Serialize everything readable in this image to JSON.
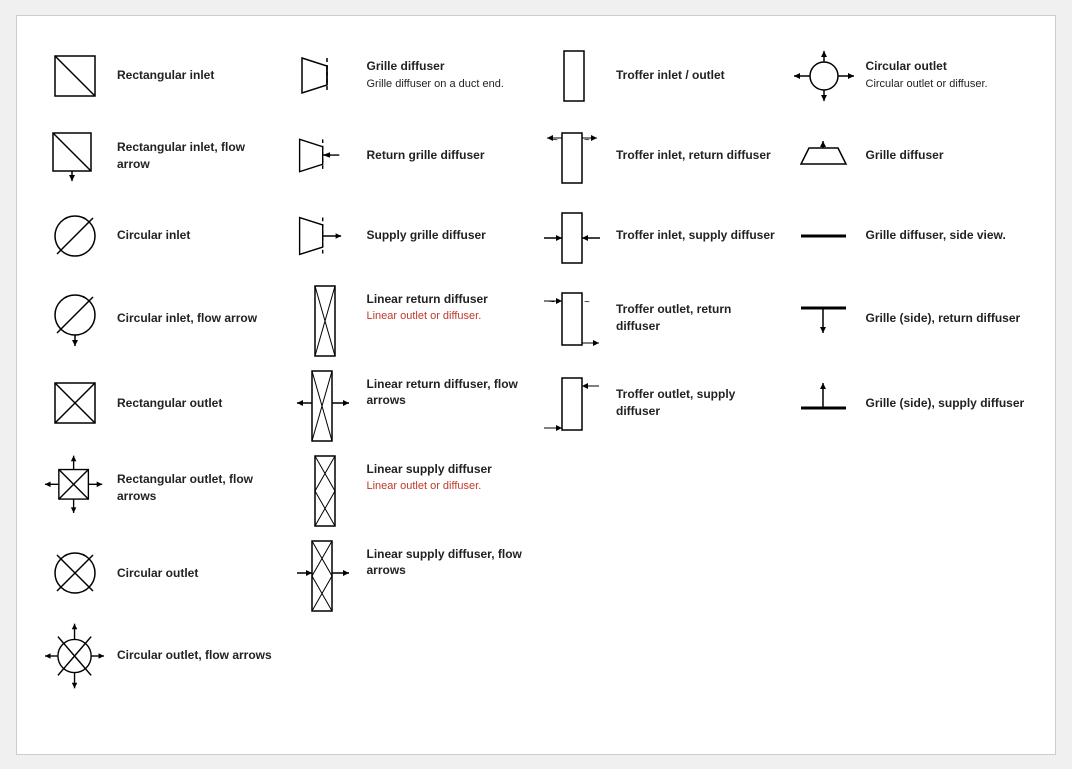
{
  "items": [
    {
      "id": "rectangular-inlet",
      "label": "Rectangular inlet",
      "sub": null,
      "sub_color": null,
      "col": 0,
      "row": 0
    },
    {
      "id": "grille-diffuser",
      "label": "Grille diffuser",
      "sub": "Grille diffuser on a duct end.",
      "sub_color": "black",
      "col": 1,
      "row": 0
    },
    {
      "id": "troffer-inlet-outlet",
      "label": "Troffer inlet / outlet",
      "sub": null,
      "sub_color": null,
      "col": 2,
      "row": 0
    },
    {
      "id": "circular-outlet-diffuser",
      "label": "Circular outlet",
      "sub": "Circular outlet or diffuser.",
      "sub_color": "black",
      "col": 3,
      "row": 0
    },
    {
      "id": "rectangular-inlet-flow",
      "label": "Rectangular inlet, flow arrow",
      "sub": null,
      "sub_color": null,
      "col": 0,
      "row": 1
    },
    {
      "id": "return-grille-diffuser",
      "label": "Return grille diffuser",
      "sub": null,
      "sub_color": null,
      "col": 1,
      "row": 1
    },
    {
      "id": "troffer-inlet-return",
      "label": "Troffer inlet, return diffuser",
      "sub": null,
      "sub_color": null,
      "col": 2,
      "row": 1
    },
    {
      "id": "grille-diffuser-2",
      "label": "Grille diffuser",
      "sub": null,
      "sub_color": null,
      "col": 3,
      "row": 1
    },
    {
      "id": "circular-inlet",
      "label": "Circular inlet",
      "sub": null,
      "sub_color": null,
      "col": 0,
      "row": 2
    },
    {
      "id": "supply-grille-diffuser",
      "label": "Supply grille diffuser",
      "sub": null,
      "sub_color": null,
      "col": 1,
      "row": 2
    },
    {
      "id": "troffer-inlet-supply",
      "label": "Troffer inlet, supply diffuser",
      "sub": null,
      "sub_color": null,
      "col": 2,
      "row": 2
    },
    {
      "id": "grille-diffuser-side",
      "label": "Grille diffuser, side view.",
      "sub": null,
      "sub_color": null,
      "col": 3,
      "row": 2
    },
    {
      "id": "circular-inlet-flow",
      "label": "Circular inlet, flow arrow",
      "sub": null,
      "sub_color": null,
      "col": 0,
      "row": 3
    },
    {
      "id": "linear-return-diffuser",
      "label": "Linear return diffuser",
      "sub": "Linear outlet or diffuser.",
      "sub_color": "red",
      "col": 1,
      "row": 3
    },
    {
      "id": "troffer-outlet-return",
      "label": "Troffer outlet, return diffuser",
      "sub": null,
      "sub_color": null,
      "col": 2,
      "row": 3
    },
    {
      "id": "grille-side-return",
      "label": "Grille (side), return diffuser",
      "sub": null,
      "sub_color": null,
      "col": 3,
      "row": 3
    },
    {
      "id": "rectangular-outlet",
      "label": "Rectangular outlet",
      "sub": null,
      "sub_color": null,
      "col": 0,
      "row": 4
    },
    {
      "id": "linear-return-flow",
      "label": "Linear return diffuser, flow arrows",
      "sub": null,
      "sub_color": null,
      "col": 1,
      "row": 4
    },
    {
      "id": "troffer-outlet-supply",
      "label": "Troffer outlet, supply diffuser",
      "sub": null,
      "sub_color": null,
      "col": 2,
      "row": 4
    },
    {
      "id": "grille-side-supply",
      "label": "Grille (side), supply diffuser",
      "sub": null,
      "sub_color": null,
      "col": 3,
      "row": 4
    },
    {
      "id": "rectangular-outlet-flow",
      "label": "Rectangular outlet, flow arrows",
      "sub": null,
      "sub_color": null,
      "col": 0,
      "row": 5
    },
    {
      "id": "linear-supply-diffuser",
      "label": "Linear supply diffuser",
      "sub": "Linear outlet or diffuser.",
      "sub_color": "red",
      "col": 1,
      "row": 5
    },
    {
      "id": "empty-1",
      "label": "",
      "sub": null,
      "col": 2,
      "row": 5
    },
    {
      "id": "empty-2",
      "label": "",
      "sub": null,
      "col": 3,
      "row": 5
    },
    {
      "id": "circular-outlet",
      "label": "Circular outlet",
      "sub": null,
      "sub_color": null,
      "col": 0,
      "row": 6
    },
    {
      "id": "linear-supply-flow",
      "label": "Linear supply diffuser, flow arrows",
      "sub": null,
      "sub_color": null,
      "col": 1,
      "row": 6
    },
    {
      "id": "empty-3",
      "label": "",
      "sub": null,
      "col": 2,
      "row": 6
    },
    {
      "id": "empty-4",
      "label": "",
      "sub": null,
      "col": 3,
      "row": 6
    },
    {
      "id": "circular-outlet-flow",
      "label": "Circular outlet, flow arrows",
      "sub": null,
      "sub_color": null,
      "col": 0,
      "row": 7
    }
  ]
}
